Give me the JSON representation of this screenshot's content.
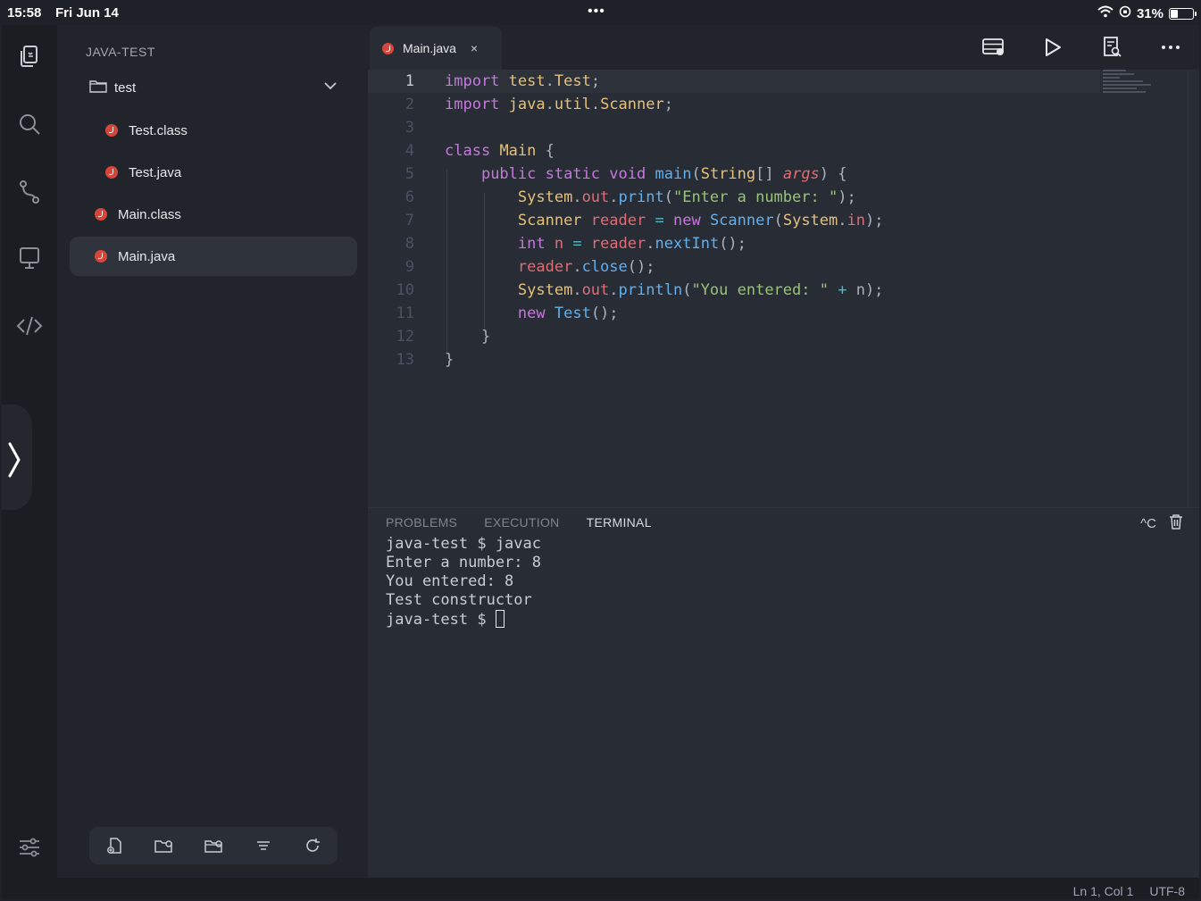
{
  "status_bar": {
    "time": "15:58",
    "date": "Fri Jun 14",
    "battery": "31%",
    "battery_level": 0.31,
    "icons": [
      "wifi-icon",
      "orientation-lock-icon",
      "battery-icon"
    ]
  },
  "activity_bar": {
    "items": [
      {
        "name": "explorer",
        "icon": "files-icon"
      },
      {
        "name": "search",
        "icon": "search-icon"
      },
      {
        "name": "source-control",
        "icon": "git-branch-icon"
      },
      {
        "name": "remote",
        "icon": "monitor-icon"
      },
      {
        "name": "code",
        "icon": "code-icon"
      }
    ],
    "bottom_icon": "sliders-icon"
  },
  "explorer": {
    "title": "JAVA-TEST",
    "items": [
      {
        "label": "test",
        "type": "folder",
        "expanded": true
      },
      {
        "label": "Test.class",
        "type": "java"
      },
      {
        "label": "Test.java",
        "type": "java"
      },
      {
        "label": "Main.class",
        "type": "java"
      },
      {
        "label": "Main.java",
        "type": "java",
        "selected": true
      }
    ],
    "toolbar": [
      "new-file-icon",
      "new-folder-icon",
      "new-folder-alt-icon",
      "filter-icon",
      "refresh-icon"
    ]
  },
  "editor": {
    "tab": {
      "label": "Main.java",
      "close": "×"
    },
    "actions": [
      "server-icon",
      "run-icon",
      "search-document-icon",
      "more-icon"
    ],
    "line_numbers": [
      "1",
      "2",
      "3",
      "4",
      "5",
      "6",
      "7",
      "8",
      "9",
      "10",
      "11",
      "12",
      "13"
    ],
    "current_line": 1
  },
  "panel": {
    "tabs": [
      "PROBLEMS",
      "EXECUTION",
      "TERMINAL"
    ],
    "active_tab": "TERMINAL",
    "interrupt_label": "^C",
    "terminal_lines": [
      "java-test $ javac",
      "Enter a number: 8",
      "You entered: 8",
      "Test constructor",
      "java-test $ "
    ]
  },
  "footer": {
    "position": "Ln 1, Col 1",
    "encoding": "UTF-8"
  },
  "colors": {
    "keyword": "#c678dd",
    "type": "#e5c07b",
    "function": "#61afef",
    "string": "#98c379",
    "variable": "#e06c75",
    "java_badge": "#d6463b"
  }
}
